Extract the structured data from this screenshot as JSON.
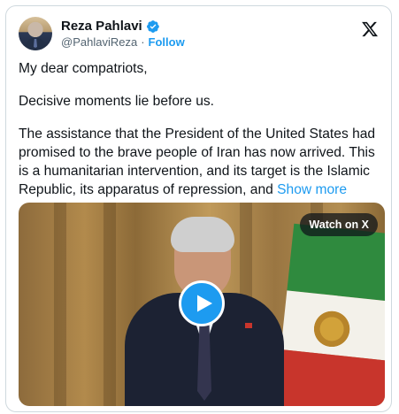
{
  "tweet": {
    "author_name": "Reza Pahlavi",
    "handle": "@PahlaviReza",
    "separator": "·",
    "follow_label": "Follow",
    "paragraphs": [
      "My dear compatriots,",
      "Decisive moments lie before us.",
      "The assistance that the President of the United States had promised to the brave people of Iran has now arrived. This is a humanitarian intervention, and its target is the Islamic Republic, its apparatus of repression, and"
    ],
    "show_more_label": "Show more"
  },
  "media": {
    "watch_on_label": "Watch on X"
  },
  "icons": {
    "verified": "verified-badge-icon",
    "platform": "x-logo-icon",
    "play": "play-icon"
  },
  "colors": {
    "accent": "#1d9bf0",
    "text": "#0f1419",
    "secondary": "#536471"
  }
}
